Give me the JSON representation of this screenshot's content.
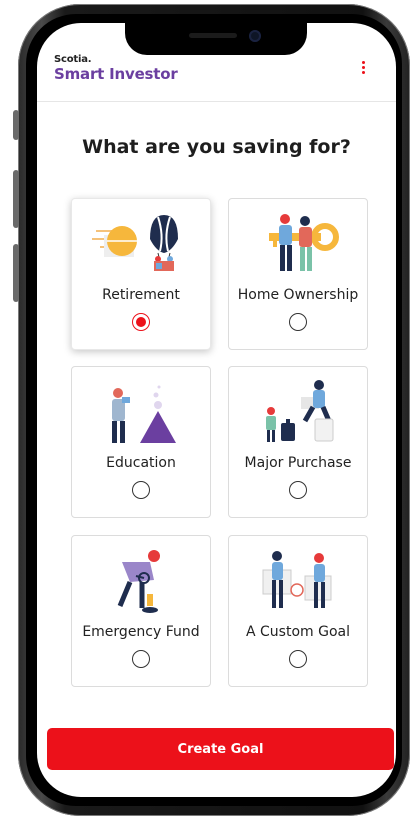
{
  "header": {
    "brand_small": "Scotia.",
    "brand_large": "Smart Investor",
    "menu_icon": "vertical-dots-icon"
  },
  "page": {
    "question": "What are you saving for?"
  },
  "goals": [
    {
      "label": "Retirement",
      "selected": true,
      "icon": "hot-air-balloon-illustration"
    },
    {
      "label": "Home Ownership",
      "selected": false,
      "icon": "house-key-illustration"
    },
    {
      "label": "Education",
      "selected": false,
      "icon": "student-reading-illustration"
    },
    {
      "label": "Major Purchase",
      "selected": false,
      "icon": "travel-luggage-illustration"
    },
    {
      "label": "Emergency Fund",
      "selected": false,
      "icon": "magnifier-coin-illustration"
    },
    {
      "label": "A Custom Goal",
      "selected": false,
      "icon": "goal-exchange-illustration"
    }
  ],
  "cta": {
    "label": "Create Goal"
  },
  "colors": {
    "accent": "#ec111a",
    "brand": "#6b3fa0"
  }
}
